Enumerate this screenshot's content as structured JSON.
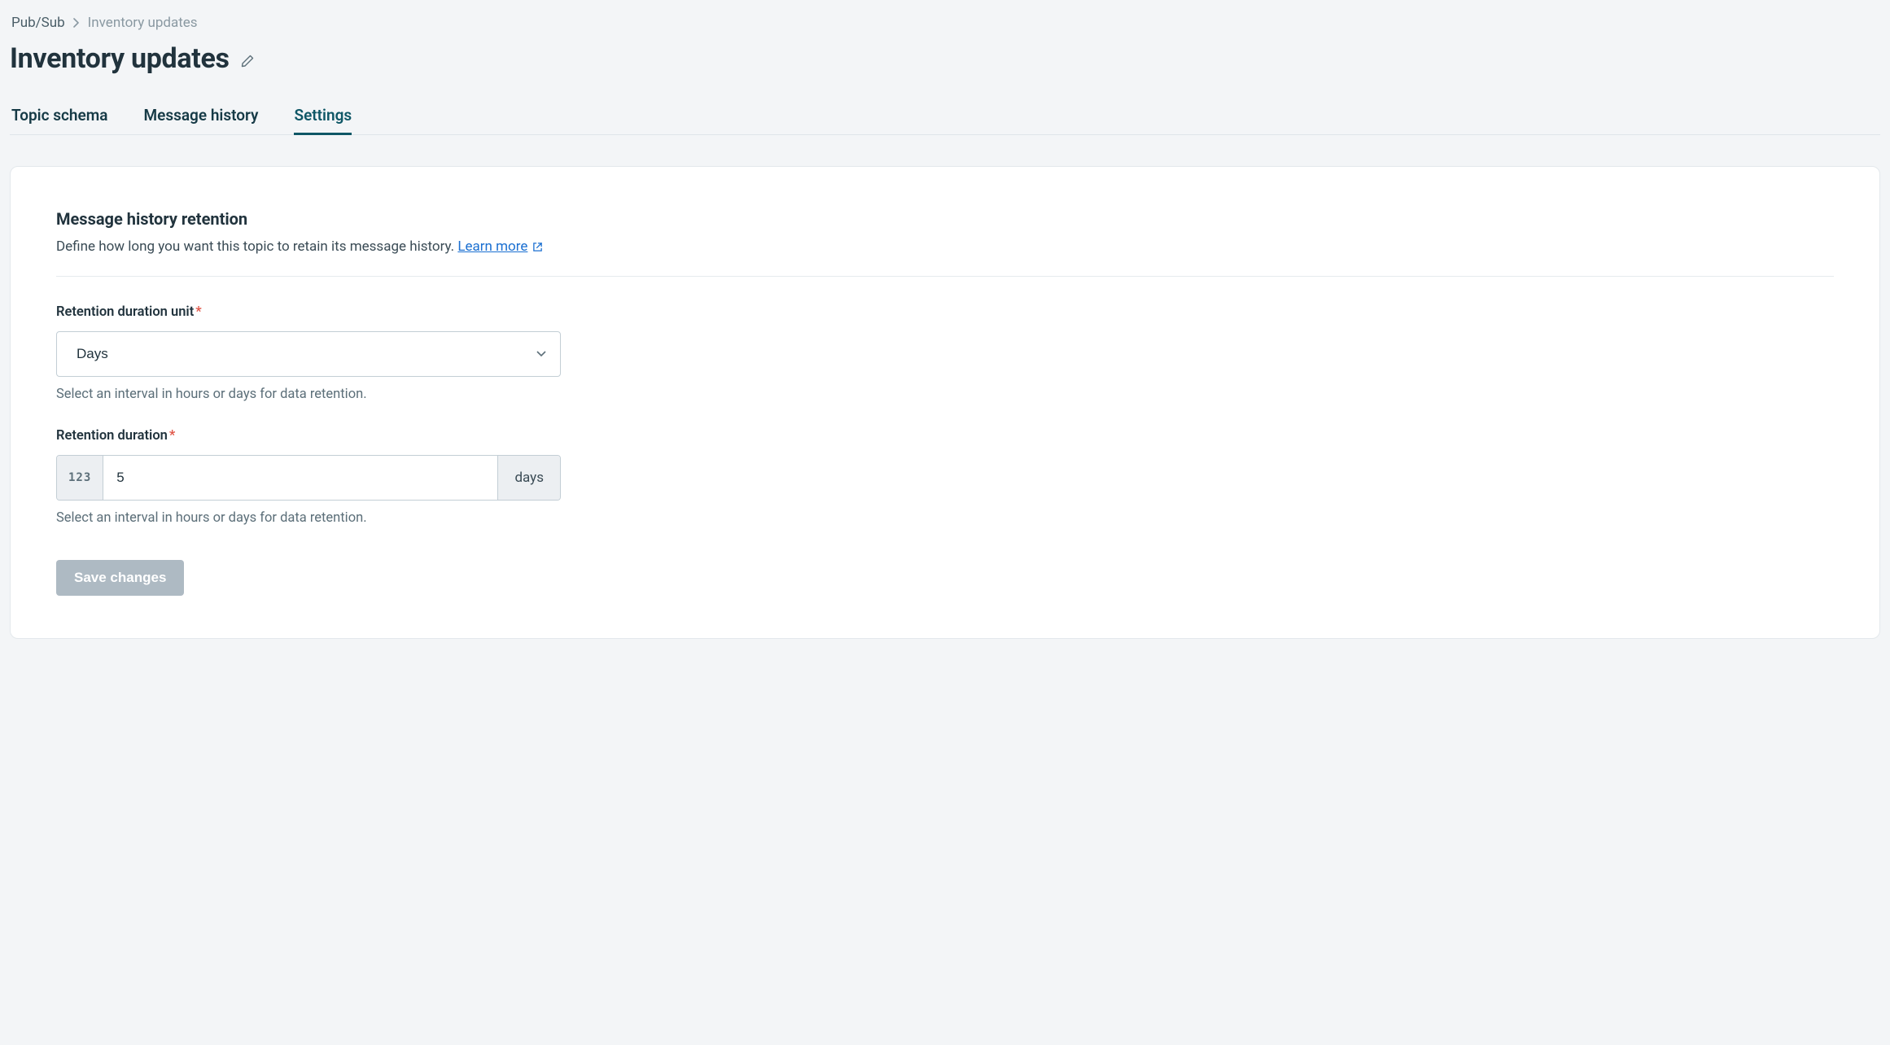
{
  "breadcrumb": {
    "root": "Pub/Sub",
    "current": "Inventory updates"
  },
  "header": {
    "title": "Inventory updates"
  },
  "tabs": [
    {
      "label": "Topic schema",
      "active": false
    },
    {
      "label": "Message history",
      "active": false
    },
    {
      "label": "Settings",
      "active": true
    }
  ],
  "settings": {
    "section_title": "Message history retention",
    "section_desc": "Define how long you want this topic to retain its message history. ",
    "learn_more": "Learn more",
    "fields": {
      "unit": {
        "label": "Retention duration unit",
        "value": "Days",
        "help": "Select an interval in hours or days for data retention."
      },
      "duration": {
        "label": "Retention duration",
        "prefix": "123",
        "value": "5",
        "suffix": "days",
        "help": "Select an interval in hours or days for data retention."
      }
    },
    "save_label": "Save changes"
  }
}
